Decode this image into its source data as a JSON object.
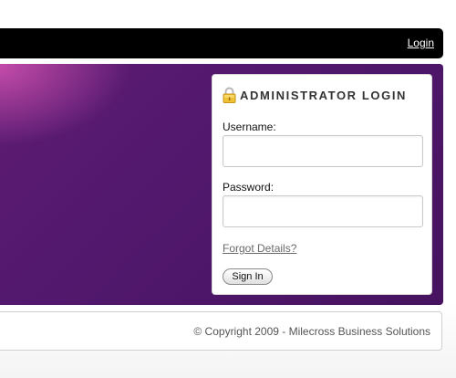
{
  "nav": {
    "login_link": "Login"
  },
  "login_card": {
    "title": "Administrator Login",
    "icon": "padlock-icon",
    "username_label": "Username:",
    "username_value": "",
    "password_label": "Password:",
    "password_value": "",
    "forgot_link": "Forgot Details?",
    "sign_in_button": "Sign In"
  },
  "footer": {
    "copyright": "© Copyright 2009 - Milecross Business Solutions"
  },
  "colors": {
    "nav_background": "#000000",
    "banner_purple": "#53196f",
    "banner_highlight": "#cd50af"
  }
}
